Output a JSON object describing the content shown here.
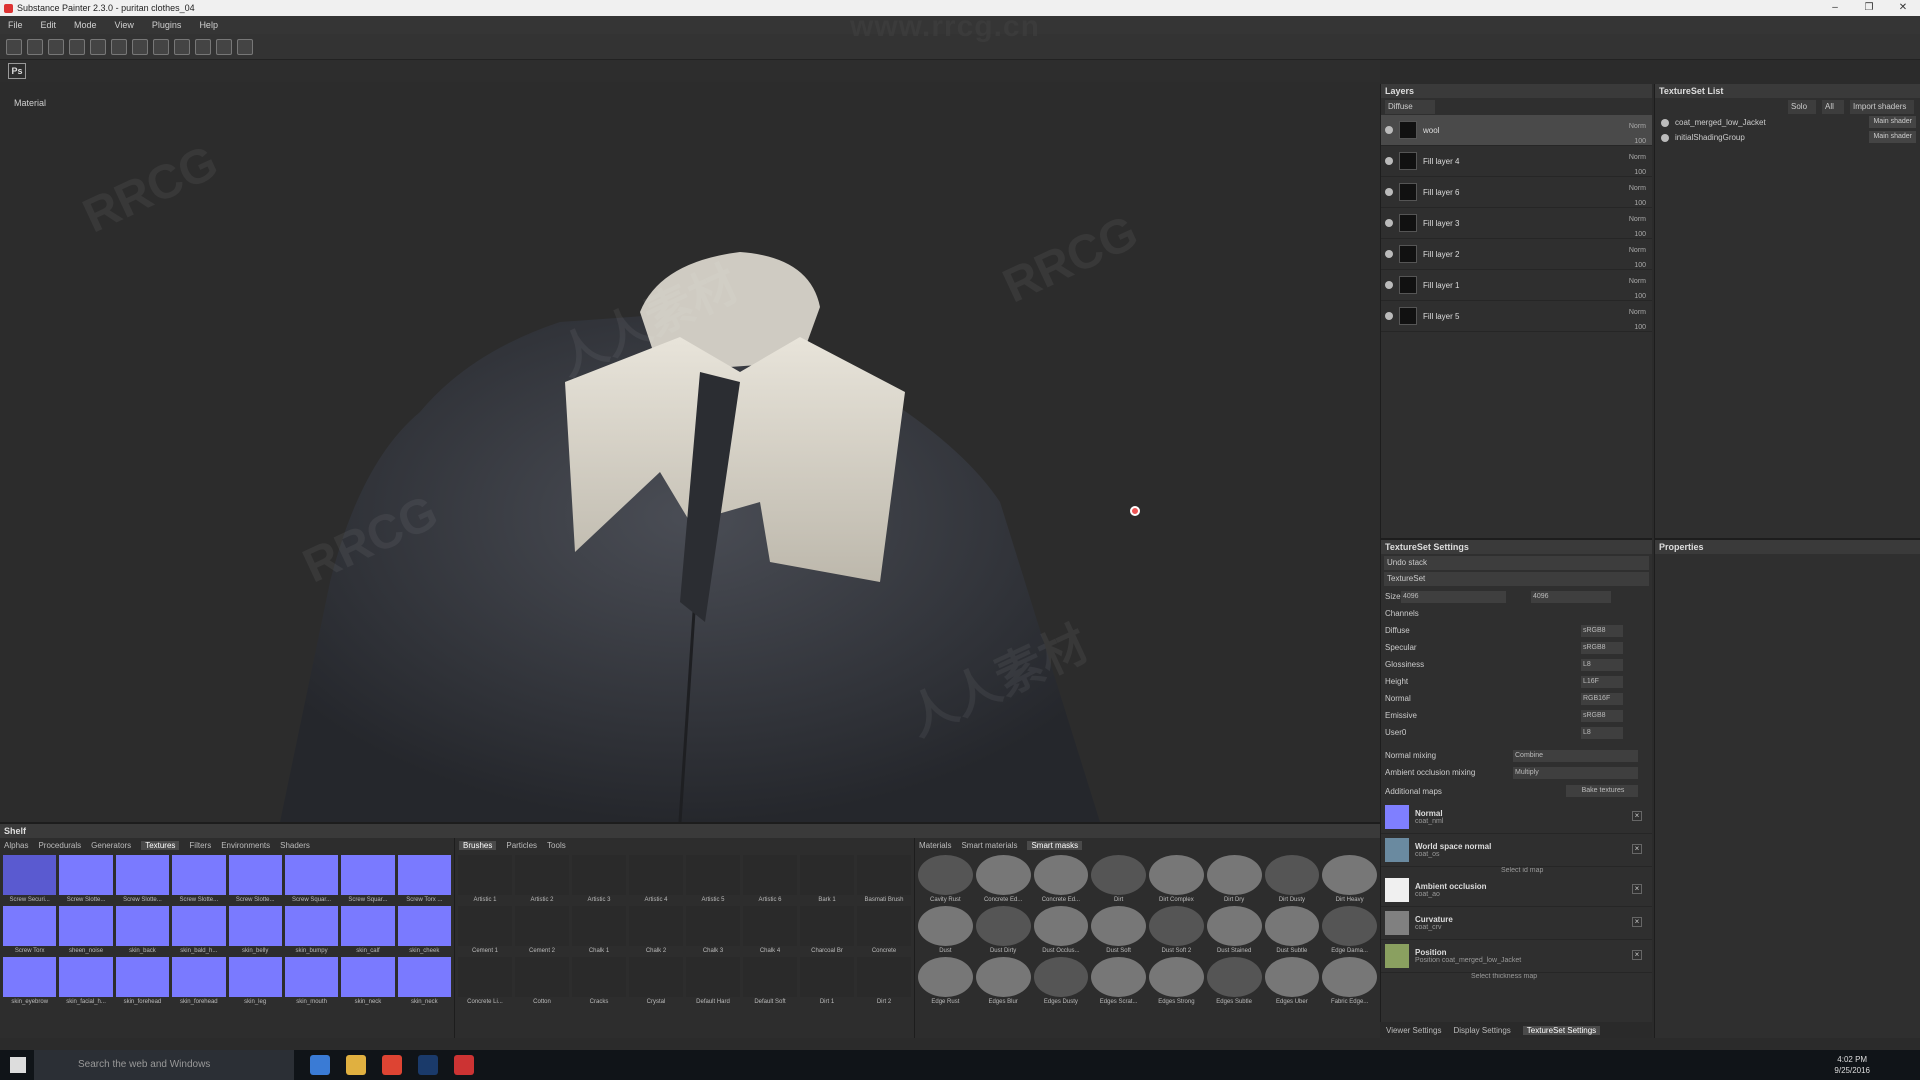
{
  "window": {
    "title": "Substance Painter 2.3.0 - puritan clothes_04",
    "controls": [
      "–",
      "❐",
      "✕"
    ]
  },
  "menu": [
    "File",
    "Edit",
    "Mode",
    "View",
    "Plugins",
    "Help"
  ],
  "watermark": "www.rrcg.cn",
  "viewport": {
    "label": "Material"
  },
  "layers": {
    "title": "Layers",
    "channel": "Diffuse",
    "items": [
      {
        "name": "wool",
        "blend": "Norm",
        "opacity": "100",
        "selected": true
      },
      {
        "name": "Fill layer 4",
        "blend": "Norm",
        "opacity": "100"
      },
      {
        "name": "Fill layer 6",
        "blend": "Norm",
        "opacity": "100"
      },
      {
        "name": "Fill layer 3",
        "blend": "Norm",
        "opacity": "100"
      },
      {
        "name": "Fill layer 2",
        "blend": "Norm",
        "opacity": "100"
      },
      {
        "name": "Fill layer 1",
        "blend": "Norm",
        "opacity": "100"
      },
      {
        "name": "Fill layer 5",
        "blend": "Norm",
        "opacity": "100"
      }
    ]
  },
  "textureset_list": {
    "title": "TextureSet List",
    "solo": "Solo",
    "all": "All",
    "import": "Import shaders",
    "items": [
      {
        "name": "coat_merged_low_Jacket",
        "shader": "Main shader"
      },
      {
        "name": "initialShadingGroup",
        "shader": "Main shader"
      }
    ]
  },
  "textureset_settings": {
    "title": "TextureSet Settings",
    "undo": "Undo stack",
    "textureset": "TextureSet",
    "size_label": "Size",
    "size_value": "4096",
    "size_value2": "4096",
    "channels_label": "Channels",
    "channels": [
      {
        "name": "Diffuse",
        "format": "sRGB8"
      },
      {
        "name": "Specular",
        "format": "sRGB8"
      },
      {
        "name": "Glossiness",
        "format": "L8"
      },
      {
        "name": "Height",
        "format": "L16F"
      },
      {
        "name": "Normal",
        "format": "RGB16F"
      },
      {
        "name": "Emissive",
        "format": "sRGB8"
      },
      {
        "name": "User0",
        "format": "L8"
      }
    ],
    "normal_mixing_label": "Normal mixing",
    "normal_mixing": "Combine",
    "ao_mixing_label": "Ambient occlusion mixing",
    "ao_mixing": "Multiply",
    "additional_maps": "Additional maps",
    "bake": "Bake textures",
    "maps": [
      {
        "title": "Normal",
        "file": "coat_nml",
        "color": "#7f7fff"
      },
      {
        "title": "World space normal",
        "file": "coat_os",
        "color": "#6a8aa0"
      },
      {
        "title": "Ambient occlusion",
        "file": "coat_ao",
        "color": "#f0f0f0"
      },
      {
        "title": "Curvature",
        "file": "coat_crv",
        "color": "#808080"
      },
      {
        "title": "Position",
        "file": "Position coat_merged_low_Jacket",
        "color": "#8aa060"
      }
    ],
    "select_id": "Select id map",
    "select_thickness": "Select thickness map"
  },
  "properties": {
    "title": "Properties"
  },
  "shelf": {
    "title": "Shelf",
    "tabs": [
      "Alphas",
      "Procedurals",
      "Generators",
      "Textures",
      "Filters",
      "Environments",
      "Shaders"
    ],
    "active_tab": "Textures",
    "search": "Search",
    "textures": [
      "Screw Securi...",
      "Screw Slotte...",
      "Screw Slotte...",
      "Screw Slotte...",
      "Screw Slotte...",
      "Screw Squar...",
      "Screw Squar...",
      "Screw Torx ...",
      "Screw Torx",
      "sheen_noise",
      "skin_back",
      "skin_bald_h...",
      "skin_belly",
      "skin_bumpy",
      "skin_calf",
      "skin_cheek",
      "skin_eyebrow",
      "skin_facial_h...",
      "skin_forehead",
      "skin_forehead",
      "skin_leg",
      "skin_mouth",
      "skin_neck",
      "skin_neck"
    ],
    "brush_tabs": [
      "Brushes",
      "Particles",
      "Tools"
    ],
    "brushes": [
      "Artistic 1",
      "Artistic 2",
      "Artistic 3",
      "Artistic 4",
      "Artistic 5",
      "Artistic 6",
      "Bark 1",
      "Basmati Brush",
      "Cement 1",
      "Cement 2",
      "Chalk 1",
      "Chalk 2",
      "Chalk 3",
      "Chalk 4",
      "Charcoal Br",
      "Concrete",
      "Concrete Li...",
      "Cotton",
      "Cracks",
      "Crystal",
      "Default Hard",
      "Default Soft",
      "Dirt 1",
      "Dirt 2"
    ],
    "mat_tabs": [
      "Materials",
      "Smart materials",
      "Smart masks"
    ],
    "masks": [
      "Cavity Rust",
      "Concrete Ed...",
      "Concrete Ed...",
      "Dirt",
      "Dirt Complex",
      "Dirt Dry",
      "Dirt Dusty",
      "Dirt Heavy",
      "Dust",
      "Dust Dirty",
      "Dust Occlus...",
      "Dust Soft",
      "Dust Soft 2",
      "Dust Stained",
      "Dust Subtle",
      "Edge Dama...",
      "Edge Rust",
      "Edges Blur",
      "Edges Dusty",
      "Edges Scrat...",
      "Edges Strong",
      "Edges Subtle",
      "Edges Uber",
      "Fabric Edge..."
    ]
  },
  "bottom_tabs": [
    "Viewer Settings",
    "Display Settings",
    "TextureSet Settings"
  ],
  "taskbar": {
    "search": "Search the web and Windows",
    "time": "4:02 PM",
    "date": "9/25/2016"
  }
}
